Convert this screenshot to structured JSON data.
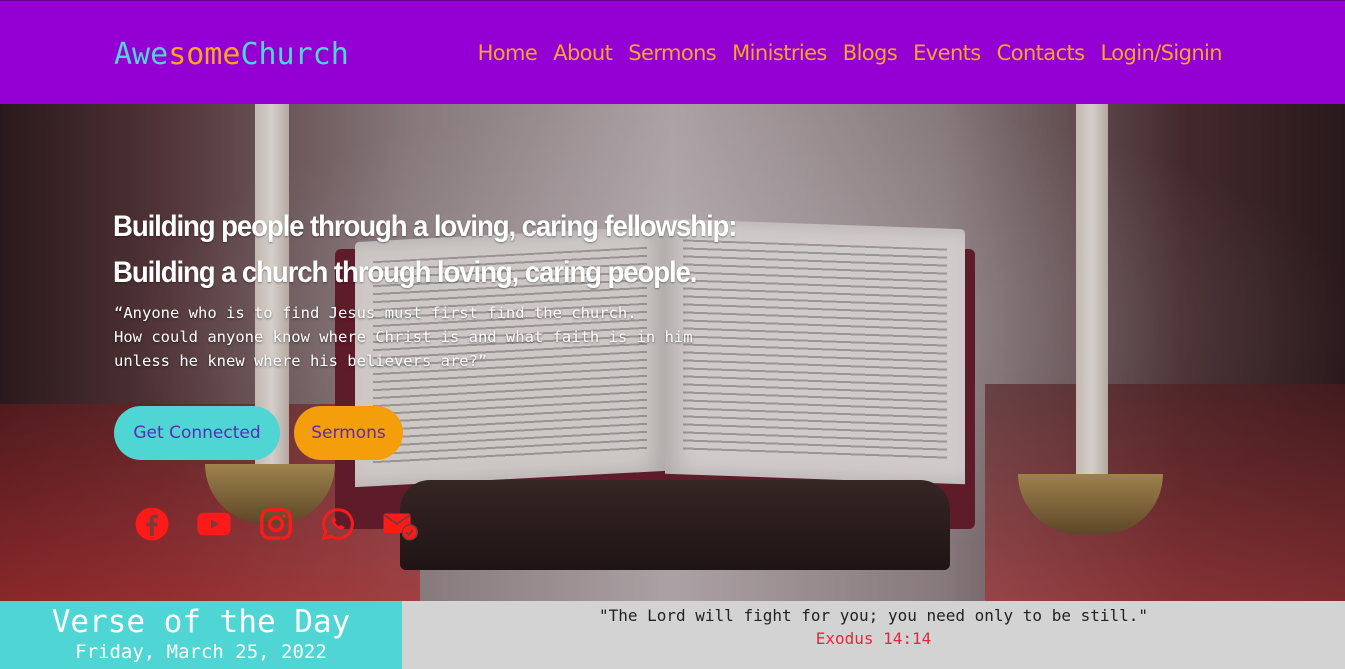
{
  "logo": {
    "part1": "Awe",
    "part2": "some",
    "part3": "Church"
  },
  "nav": [
    "Home",
    "About",
    "Sermons",
    "Ministries",
    "Blogs",
    "Events",
    "Contacts",
    "Login/Signin"
  ],
  "hero": {
    "headline_line1": "Building people through a loving, caring fellowship:",
    "headline_line2": "Building a church through loving, caring people.",
    "quote": "“Anyone who is to find Jesus must first find the church.\nHow could anyone know where Christ is and what faith is in him\nunless he knew where his believers are?”",
    "btn_connect": "Get Connected",
    "btn_sermons": "Sermons"
  },
  "socials": [
    "facebook-icon",
    "youtube-icon",
    "instagram-icon",
    "whatsapp-icon",
    "email-icon"
  ],
  "colors": {
    "header": "#9400d3",
    "accent_teal": "#4fd6d4",
    "accent_orange": "#f5a623",
    "social_red": "#ff1a1a"
  },
  "verse": {
    "title": "Verse of the Day",
    "date": "Friday, March 25, 2022",
    "text": "\"The Lord will fight for you; you need only to be still.\"",
    "reference": "Exodus 14:14"
  }
}
